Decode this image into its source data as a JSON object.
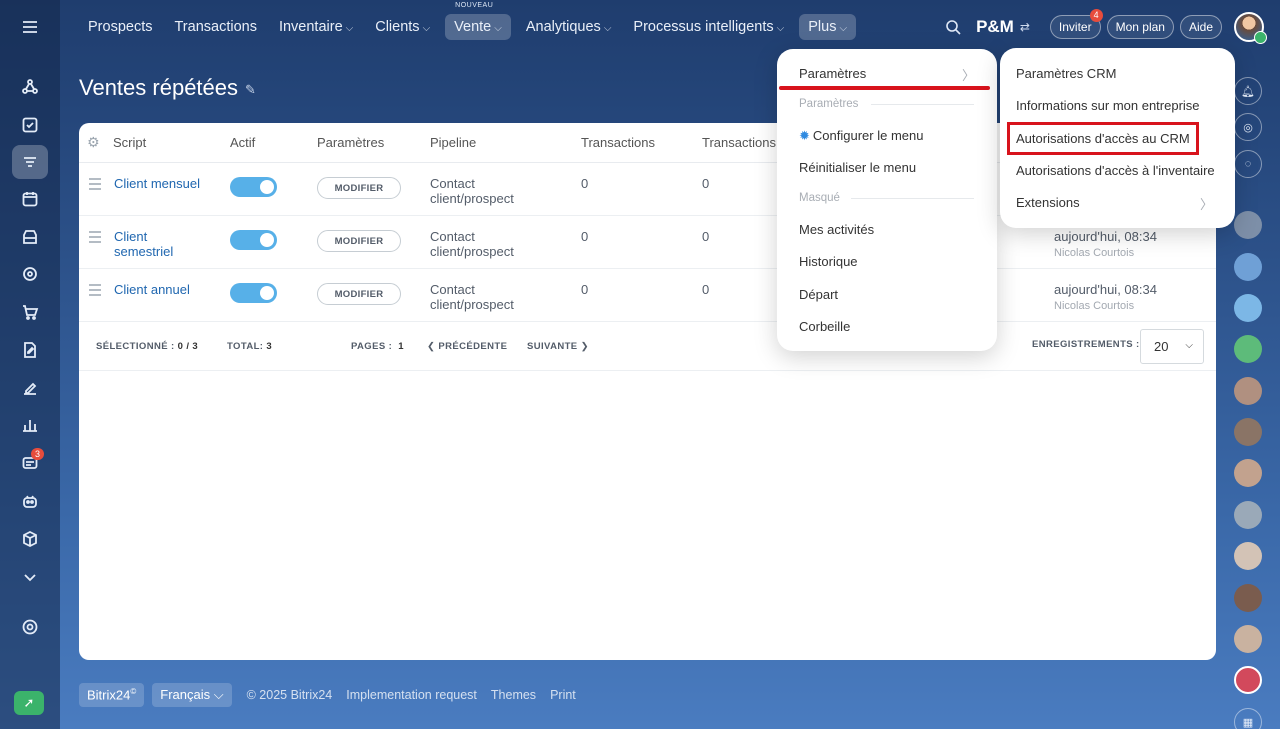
{
  "nav": {
    "items": [
      {
        "label": "Prospects"
      },
      {
        "label": "Transactions"
      },
      {
        "label": "Inventaire"
      },
      {
        "label": "Clients"
      },
      {
        "label": "Vente",
        "tag": "NOUVEAU"
      },
      {
        "label": "Analytiques"
      },
      {
        "label": "Processus intelligents"
      },
      {
        "label": "Plus"
      }
    ],
    "brand": "P&M",
    "invite_label": "Inviter",
    "invite_badge": "4",
    "plan_label": "Mon plan",
    "help_label": "Aide"
  },
  "left_sidebar": {
    "chat_badge": "3"
  },
  "page": {
    "title": "Ventes répétées"
  },
  "grid": {
    "headers": [
      "Script",
      "Actif",
      "Paramètres",
      "Pipeline",
      "Transactions",
      "Transactions"
    ],
    "rows": [
      {
        "script": "Client mensuel",
        "action": "MODIFIER",
        "pipeline_1": "Contact",
        "pipeline_2": "client/prospect",
        "tx1": "0",
        "tx2": "0",
        "date": "",
        "author": ""
      },
      {
        "script_1": "Client",
        "script_2": "semestriel",
        "action": "MODIFIER",
        "pipeline_1": "Contact",
        "pipeline_2": "client/prospect",
        "tx1": "0",
        "tx2": "0",
        "date": "aujourd'hui, 08:34",
        "author": "Nicolas Courtois"
      },
      {
        "script": "Client annuel",
        "action": "MODIFIER",
        "pipeline_1": "Contact",
        "pipeline_2": "client/prospect",
        "tx1": "0",
        "tx2": "0",
        "date": "aujourd'hui, 08:34",
        "author": "Nicolas Courtois"
      }
    ],
    "footer": {
      "selected_label": "SÉLECTIONNÉ :",
      "selected_value": "0 / 3",
      "total_label": "TOTAL:",
      "total_value": "3",
      "pages_label": "PAGES :",
      "pages_value": "1",
      "prev_label": "PRÉCÉDENTE",
      "next_label": "SUIVANTE",
      "records_label": "ENREGISTREMENTS :",
      "records_value": "20"
    }
  },
  "menu_more": {
    "items": [
      {
        "label": "Paramètres"
      },
      {
        "label": "Paramètres",
        "kind": "section"
      },
      {
        "label": "Configurer le menu"
      },
      {
        "label": "Réinitialiser le menu"
      },
      {
        "label": "Masqué",
        "kind": "section"
      },
      {
        "label": "Mes activités"
      },
      {
        "label": "Historique"
      },
      {
        "label": "Départ"
      },
      {
        "label": "Corbeille"
      }
    ]
  },
  "menu_settings": {
    "items": [
      {
        "label": "Paramètres CRM"
      },
      {
        "label": "Informations sur mon entreprise"
      },
      {
        "label": "Autorisations d'accès au CRM",
        "highlighted": true
      },
      {
        "label": "Autorisations d'accès à l'inventaire"
      },
      {
        "label": "Extensions"
      }
    ]
  },
  "page_footer": {
    "bitrix_label": "Bitrix24",
    "lang_label": "Français",
    "copyright": "© 2025 Bitrix24",
    "impl_label": "Implementation request",
    "themes_label": "Themes",
    "print_label": "Print"
  },
  "colors": {
    "accent": "#57b0e8",
    "highlight_red": "#d8131c",
    "link": "#2067b0"
  }
}
